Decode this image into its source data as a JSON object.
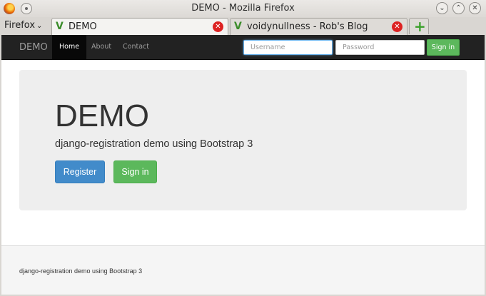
{
  "window": {
    "title": "DEMO - Mozilla Firefox",
    "minimize_glyph": "⌄",
    "maximize_glyph": "⌃",
    "close_glyph": "✕"
  },
  "browser": {
    "menu_label": "Firefox",
    "menu_chevron": "⌄",
    "tabs": [
      {
        "label": "DEMO",
        "favicon": "V",
        "close_glyph": "✕"
      },
      {
        "label": "voidynullness - Rob's Blog",
        "favicon": "V",
        "close_glyph": "✕"
      }
    ],
    "new_tab_glyph": "+"
  },
  "navbar": {
    "brand": "DEMO",
    "links": [
      "Home",
      "About",
      "Contact"
    ],
    "username_placeholder": "Username",
    "password_placeholder": "Password",
    "signin_label": "Sign in"
  },
  "jumbotron": {
    "heading": "DEMO",
    "lead": "django-registration demo using Bootstrap 3",
    "register_label": "Register",
    "signin_label": "Sign in"
  },
  "footer": {
    "text": "django-registration demo using Bootstrap 3"
  },
  "colors": {
    "navbar_bg": "#222222",
    "primary": "#428bca",
    "success": "#5cb85c",
    "jumbotron_bg": "#eeeeee",
    "tab_close": "#dd2222"
  }
}
